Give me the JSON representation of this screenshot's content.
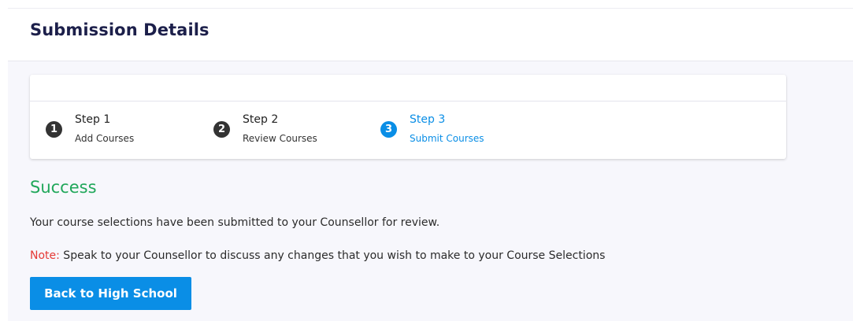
{
  "header": {
    "title": "Submission Details"
  },
  "stepper": {
    "steps": [
      {
        "number": "1",
        "title": "Step 1",
        "subtitle": "Add Courses",
        "state": "complete"
      },
      {
        "number": "2",
        "title": "Step 2",
        "subtitle": "Review Courses",
        "state": "complete"
      },
      {
        "number": "3",
        "title": "Step 3",
        "subtitle": "Submit Courses",
        "state": "active"
      }
    ]
  },
  "result": {
    "heading": "Success",
    "message": "Your course selections have been submitted to your Counsellor for review.",
    "note_label": "Note:",
    "note_text": " Speak to your Counsellor to discuss any changes that you wish to make to your Course Selections"
  },
  "actions": {
    "back_label": "Back to High School"
  },
  "colors": {
    "accent": "#0a8ee6",
    "success": "#20a75a",
    "note": "#e53935",
    "title": "#1c1f4a"
  }
}
